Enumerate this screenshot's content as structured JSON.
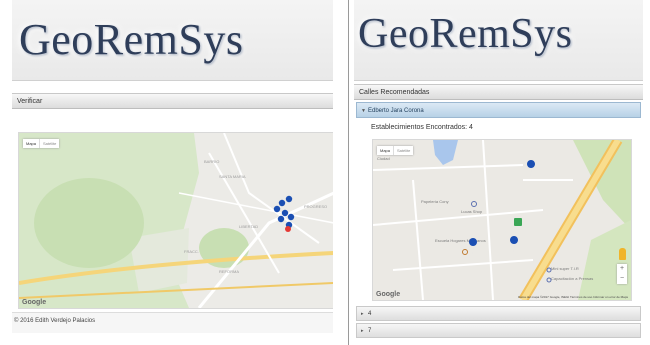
{
  "left": {
    "logo": "GeoRemSys",
    "section_bar": "Verificar",
    "map": {
      "map_type": [
        "Mapa",
        "Satélite"
      ],
      "google": "Google"
    },
    "footer": "© 2016 Edith Verdejo Palacios"
  },
  "right": {
    "logo": "GeoRemSys",
    "section_bar": "Calles Recomendadas",
    "accordion": [
      {
        "label": "Edberto Jara Corona",
        "state": "expanded"
      },
      {
        "label": "4",
        "state": "collapsed"
      },
      {
        "label": "7",
        "state": "collapsed"
      }
    ],
    "found_text": "Establecimientos Encontrados: 4",
    "map": {
      "map_type": [
        "Mapa",
        "Satélite"
      ],
      "google": "Google",
      "attribution": "Datos del mapa ©2017 Google, INEGI   Términos de uso   Informar un error de Maps",
      "places": [
        "Papelería Cony",
        "Lucas Shop",
        "Escuela Hogares Mexicanos",
        "Mini super T.I.R",
        "Capacitación a Prensas",
        "Ciudad"
      ]
    }
  },
  "colors": {
    "pin": "#1b4fb3",
    "accent": "#b7d1e6"
  }
}
